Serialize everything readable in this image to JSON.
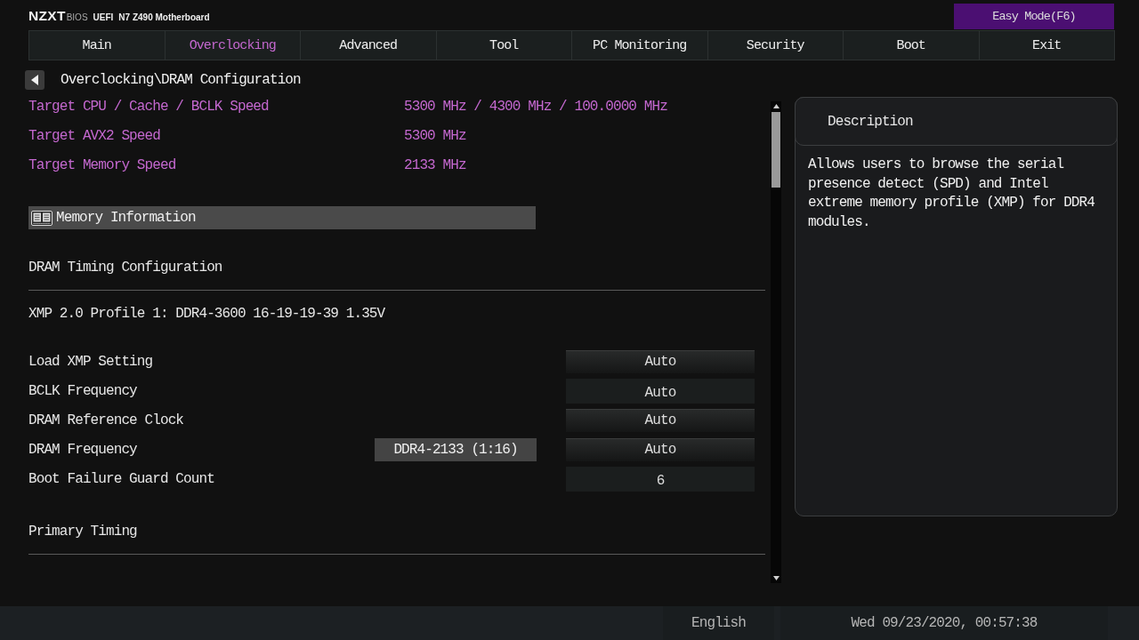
{
  "header": {
    "logo": "NZXT",
    "logo_suffix": "BIOS",
    "firmware": "UEFI",
    "board": "N7 Z490 Motherboard",
    "mode_button": "Easy Mode(F6)"
  },
  "tabs": [
    {
      "label": "Main",
      "selected": false
    },
    {
      "label": "Overclocking",
      "selected": true
    },
    {
      "label": "Advanced",
      "selected": false
    },
    {
      "label": "Tool",
      "selected": false
    },
    {
      "label": "PC Monitoring",
      "selected": false
    },
    {
      "label": "Security",
      "selected": false
    },
    {
      "label": "Boot",
      "selected": false
    },
    {
      "label": "Exit",
      "selected": false
    }
  ],
  "breadcrumb": {
    "path": "Overclocking\\DRAM Configuration"
  },
  "targets": [
    {
      "label": "Target CPU / Cache / BCLK Speed",
      "value": "5300 MHz / 4300 MHz / 100.0000 MHz"
    },
    {
      "label": "Target AVX2 Speed",
      "value": "5300 MHz"
    },
    {
      "label": "Target Memory Speed",
      "value": "2133 MHz"
    }
  ],
  "items": [
    {
      "kind": "submenu",
      "label": "Memory Information"
    },
    {
      "kind": "heading",
      "label": "DRAM Timing Configuration"
    },
    {
      "kind": "text",
      "label": "XMP 2.0 Profile 1: DDR4-3600 16-19-19-39 1.35V"
    },
    {
      "kind": "dropdown",
      "label": "Load XMP Setting",
      "value": "Auto"
    },
    {
      "kind": "input",
      "label": "BCLK Frequency",
      "value": "Auto"
    },
    {
      "kind": "dropdown",
      "label": "DRAM Reference Clock",
      "value": "Auto"
    },
    {
      "kind": "dropdown",
      "label": "DRAM Frequency",
      "current": "DDR4-2133 (1:16)",
      "value": "Auto"
    },
    {
      "kind": "input",
      "label": "Boot Failure Guard Count",
      "value": "6"
    },
    {
      "kind": "heading",
      "label": "Primary Timing"
    }
  ],
  "description": {
    "title": "Description",
    "text": "Allows users to browse the serial presence detect (SPD) and Intel extreme memory profile (XMP) for DDR4 modules."
  },
  "status_bar": {
    "language": "English",
    "datetime": "Wed 09/23/2020, 00:57:38"
  }
}
